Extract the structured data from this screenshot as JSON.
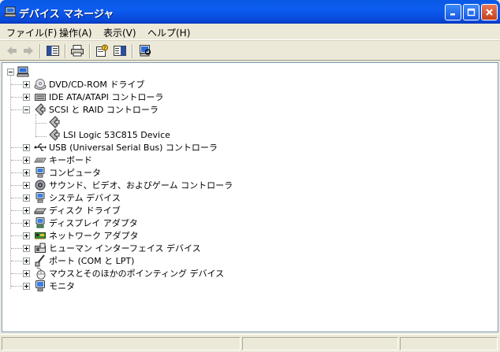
{
  "window": {
    "title": "デバイス マネージャ"
  },
  "menu": [
    {
      "label": "ファイル(F)"
    },
    {
      "label": "操作(A)"
    },
    {
      "label": "表示(V)"
    },
    {
      "label": "ヘルプ(H)"
    }
  ],
  "tree": {
    "root_expander": "minus",
    "items": [
      {
        "label": "DVD/CD-ROM ドライブ",
        "icon": "cdrom-icon"
      },
      {
        "label": "IDE ATA/ATAPI コントローラ",
        "icon": "ide-controller-icon"
      },
      {
        "label": "SCSI と RAID コントローラ",
        "icon": "scsi-icon"
      },
      {
        "label": "LSI Logic 53C815 Device",
        "icon": "scsi-device-icon"
      },
      {
        "label": "USB (Universal Serial Bus) コントローラ",
        "icon": "usb-icon"
      },
      {
        "label": "キーボード",
        "icon": "keyboard-icon"
      },
      {
        "label": "コンピュータ",
        "icon": "computer-icon"
      },
      {
        "label": "サウンド、ビデオ、およびゲーム コントローラ",
        "icon": "sound-icon"
      },
      {
        "label": "システム デバイス",
        "icon": "system-device-icon"
      },
      {
        "label": "ディスク ドライブ",
        "icon": "disk-drive-icon"
      },
      {
        "label": "ディスプレイ アダプタ",
        "icon": "display-adapter-icon"
      },
      {
        "label": "ネットワーク アダプタ",
        "icon": "network-adapter-icon"
      },
      {
        "label": "ヒューマン インターフェイス デバイス",
        "icon": "hid-icon"
      },
      {
        "label": "ポート (COM と LPT)",
        "icon": "port-icon"
      },
      {
        "label": "マウスとそのほかのポインティング デバイス",
        "icon": "mouse-icon"
      },
      {
        "label": "モニタ",
        "icon": "monitor-icon"
      }
    ]
  }
}
